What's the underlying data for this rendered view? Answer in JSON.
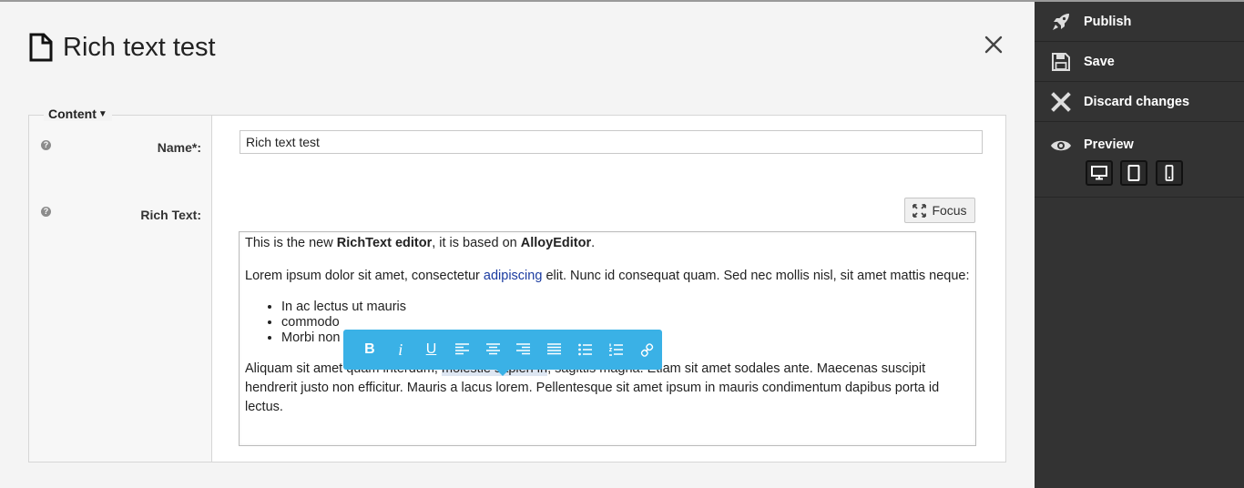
{
  "page": {
    "title": "Rich text test",
    "close_icon": "close-icon",
    "doc_icon": "document-icon"
  },
  "form": {
    "group_legend": "Content",
    "name_label": "Name*:",
    "name_value": "Rich text test",
    "richtext_label": "Rich Text:",
    "focus_label": "Focus"
  },
  "editor": {
    "p1": {
      "t1": "This is the new ",
      "b1": "RichText editor",
      "t2": ", it is based on ",
      "b2": "AlloyEditor",
      "t3": "."
    },
    "p2": {
      "t1": "Lorem ipsum dolor sit amet, consectetur ",
      "link": "adipiscing",
      "t2": " elit. Nunc id consequat quam. Sed nec mollis nisl, sit amet mattis neque:"
    },
    "list": [
      "In ac lectus ut mauris",
      "commodo",
      "Morbi non"
    ],
    "p3": {
      "t1": "Aliquam sit amet quam interdum, ",
      "sel": "molestie sapien in",
      "t2": ", sagittis magna. Etiam sit amet sodales ante. Maecenas suscipit hendrerit justo non efficitur. Mauris a lacus lorem. Pellentesque sit amet ipsum in mauris condimentum dapibus porta id lectus."
    }
  },
  "toolbar": {
    "bold": "B",
    "italic": "i",
    "underline": "U",
    "buttons": [
      "bold",
      "italic",
      "underline",
      "align-left",
      "align-center",
      "align-right",
      "align-justify",
      "bulleted-list",
      "numbered-list",
      "link"
    ],
    "color": "#3ab1e6"
  },
  "sidebar": {
    "publish": "Publish",
    "save": "Save",
    "discard": "Discard changes",
    "preview": "Preview",
    "devices": [
      "desktop",
      "tablet",
      "mobile"
    ]
  }
}
